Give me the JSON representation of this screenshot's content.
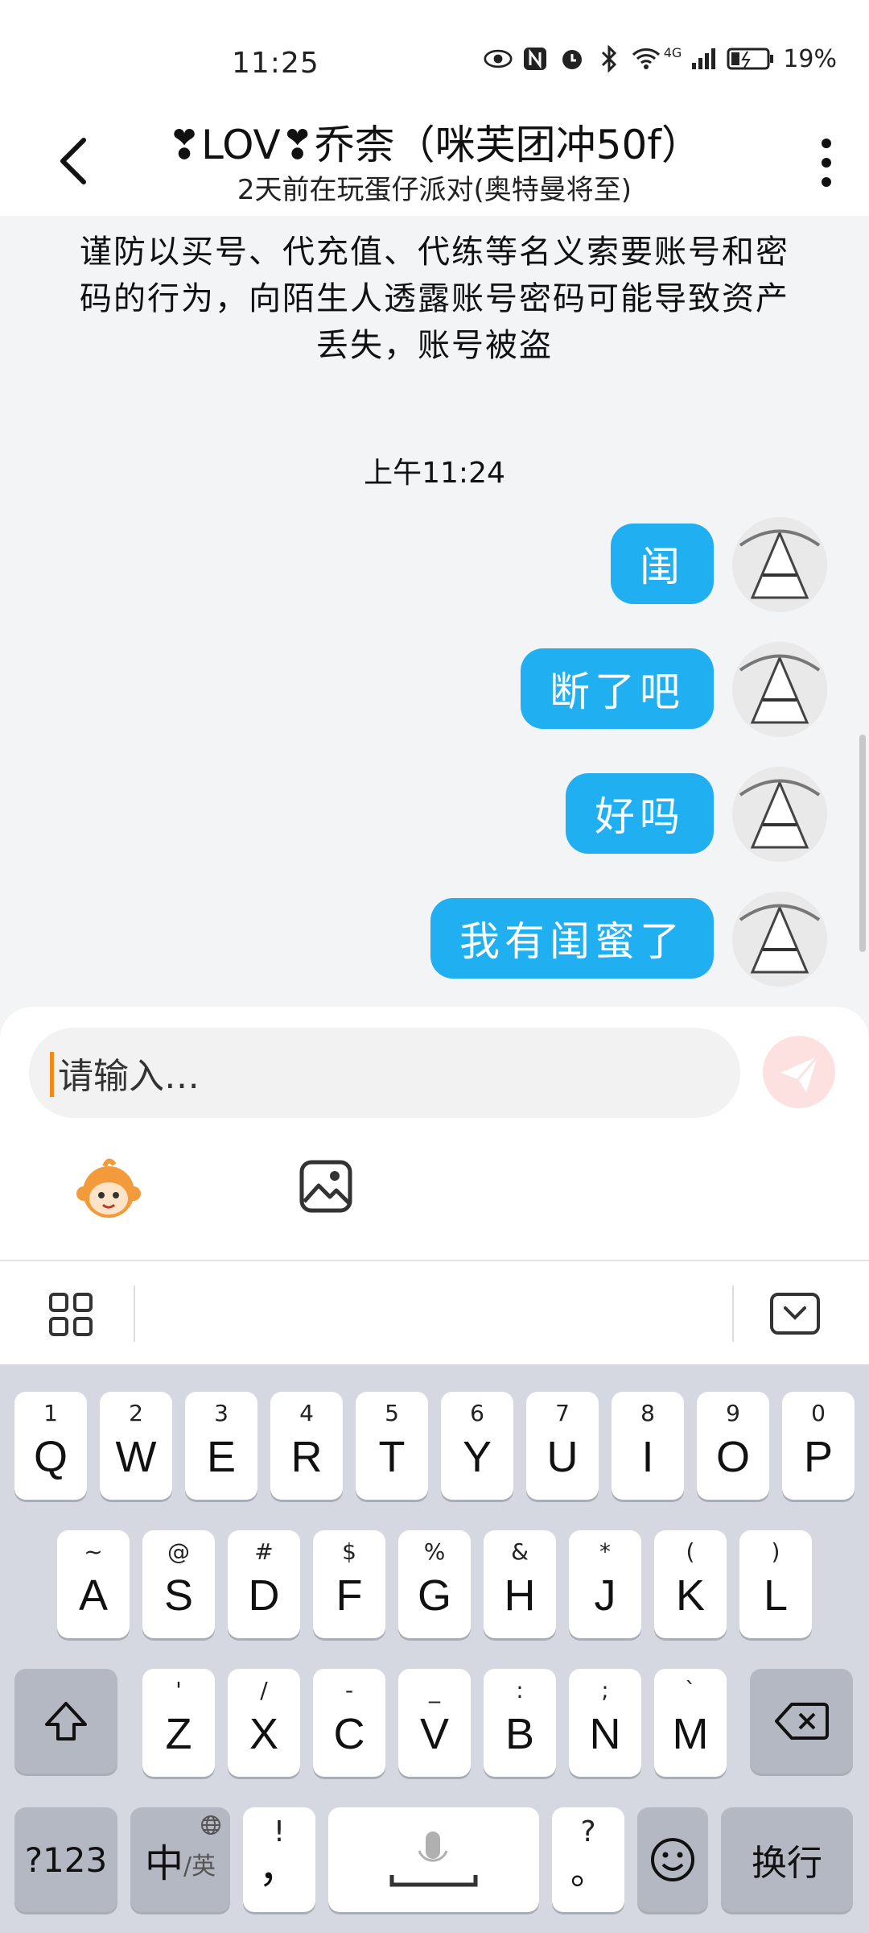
{
  "status_bar": {
    "time": "11:25",
    "network": "4G",
    "battery": "19%"
  },
  "header": {
    "title": "❣LOV❣乔柰（咪芙团冲50f）",
    "subtitle": "2天前在玩蛋仔派对(奥特曼将至)"
  },
  "chat": {
    "security_note": "谨防以买号、代充值、代练等名义索要账号和密码的行为，向陌生人透露账号密码可能导致资产丢失，账号被盗",
    "timestamp": "上午11:24",
    "messages": [
      {
        "text": "闺",
        "sender": "me"
      },
      {
        "text": "断了吧",
        "sender": "me"
      },
      {
        "text": "好吗",
        "sender": "me"
      },
      {
        "text": "我有闺蜜了",
        "sender": "me"
      }
    ]
  },
  "input": {
    "placeholder": "请输入…"
  },
  "keyboard": {
    "row1": [
      {
        "ch": "Q",
        "num": "1"
      },
      {
        "ch": "W",
        "num": "2"
      },
      {
        "ch": "E",
        "num": "3"
      },
      {
        "ch": "R",
        "num": "4"
      },
      {
        "ch": "T",
        "num": "5"
      },
      {
        "ch": "Y",
        "num": "6"
      },
      {
        "ch": "U",
        "num": "7"
      },
      {
        "ch": "I",
        "num": "8"
      },
      {
        "ch": "O",
        "num": "9"
      },
      {
        "ch": "P",
        "num": "0"
      }
    ],
    "row2": [
      {
        "ch": "A",
        "num": "~"
      },
      {
        "ch": "S",
        "num": "@"
      },
      {
        "ch": "D",
        "num": "#"
      },
      {
        "ch": "F",
        "num": "$"
      },
      {
        "ch": "G",
        "num": "%"
      },
      {
        "ch": "H",
        "num": "&"
      },
      {
        "ch": "J",
        "num": "*"
      },
      {
        "ch": "K",
        "num": "("
      },
      {
        "ch": "L",
        "num": ")"
      }
    ],
    "row3": [
      {
        "ch": "Z",
        "num": "'"
      },
      {
        "ch": "X",
        "num": "/"
      },
      {
        "ch": "C",
        "num": "-"
      },
      {
        "ch": "V",
        "num": "_"
      },
      {
        "ch": "B",
        "num": ":"
      },
      {
        "ch": "N",
        "num": ";"
      },
      {
        "ch": "M",
        "num": "`"
      }
    ],
    "symbols_key": "?123",
    "lang_key": "中",
    "lang_sub": "/英",
    "comma_top": "!",
    "comma_bottom": "，",
    "period_top": "?",
    "period_bottom": "。",
    "enter_key": "换行"
  },
  "colors": {
    "bubble": "#20b0f1",
    "caret": "#f28a1a",
    "send_button": "#fde1e1"
  }
}
